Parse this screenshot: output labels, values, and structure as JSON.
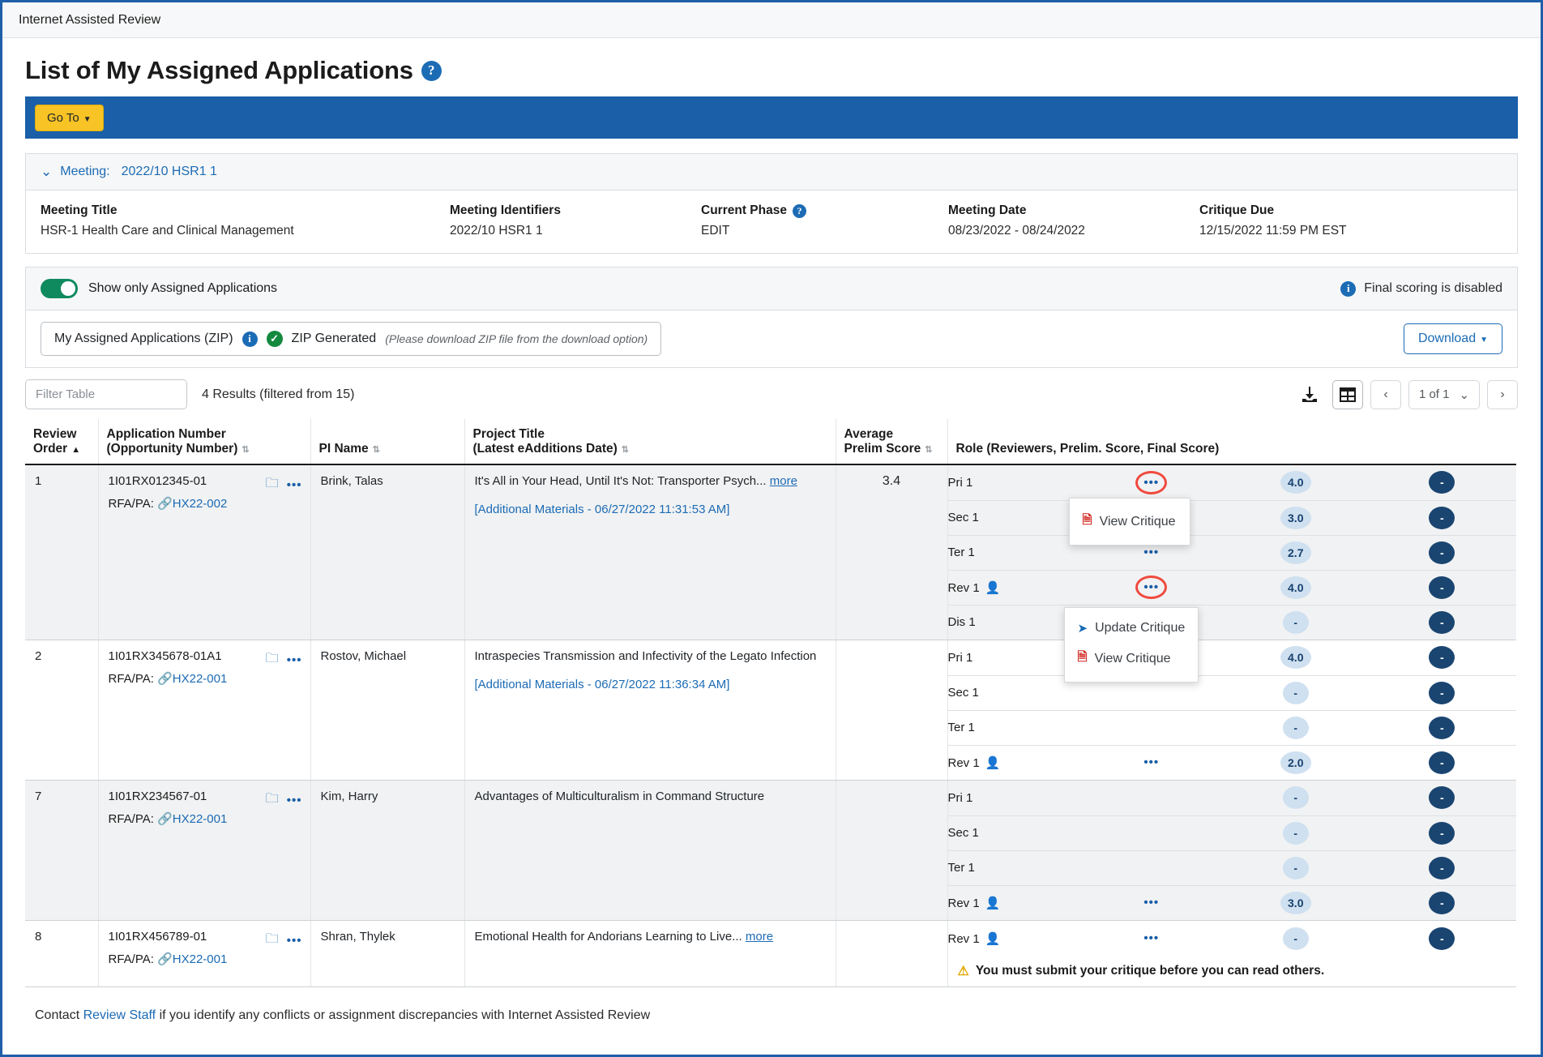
{
  "window": {
    "title": "Internet Assisted Review"
  },
  "header": {
    "page_title": "List of My Assigned Applications",
    "help_icon": "question-circle-icon",
    "goto_label": "Go To"
  },
  "meeting_panel": {
    "collapse_icon": "chevron-down-icon",
    "header_label": "Meeting:",
    "header_value": "2022/10 HSR1 1",
    "fields": [
      {
        "label": "Meeting Title",
        "value": "HSR-1 Health Care and Clinical Management"
      },
      {
        "label": "Meeting Identifiers",
        "value": "2022/10 HSR1 1"
      },
      {
        "label": "Current Phase",
        "value": "EDIT",
        "help": true
      },
      {
        "label": "Meeting Date",
        "value": "08/23/2022 - 08/24/2022"
      },
      {
        "label": "Critique Due",
        "value": "12/15/2022 11:59 PM EST"
      }
    ]
  },
  "toolbar": {
    "toggle_label": "Show only Assigned Applications",
    "toggle_on": true,
    "final_scoring_text": "Final scoring is disabled",
    "info_icon": "info-circle-icon"
  },
  "zip": {
    "label": "My Assigned Applications (ZIP)",
    "info_icon": "info-circle-icon",
    "status_icon": "check-circle-icon",
    "status": "ZIP Generated",
    "note": "(Please download ZIP file from the download option)",
    "download_label": "Download"
  },
  "table_controls": {
    "filter_placeholder": "Filter Table",
    "filter_value": "",
    "results_text": "4 Results (filtered from 15)",
    "download_icon": "download-icon",
    "grid_icon": "table-grid-icon",
    "prev_icon": "chevron-left-icon",
    "next_icon": "chevron-right-icon",
    "page_label": "1 of 1",
    "page_caret_icon": "chevron-down-icon"
  },
  "table": {
    "columns": [
      {
        "line1": "Review",
        "line2": "Order",
        "sort": "asc"
      },
      {
        "line1": "Application Number",
        "line2": "(Opportunity Number)",
        "sort": "both"
      },
      {
        "line1": "",
        "line2": "PI Name",
        "sort": "both"
      },
      {
        "line1": "Project Title",
        "line2": "(Latest eAdditions Date)",
        "sort": "both"
      },
      {
        "line1": "Average",
        "line2": "Prelim Score",
        "sort": "both"
      },
      {
        "line1": "",
        "line2": "Role (Reviewers, Prelim. Score, Final Score)",
        "sort": "none"
      }
    ],
    "rows": [
      {
        "order": "1",
        "app_number": "1I01RX012345-01",
        "rfa_label": "RFA/PA:",
        "rfa_link": "HX22-002",
        "folder_icon": "folder-open-icon",
        "more_icon": "ellipsis-icon",
        "pi_name": "Brink, Talas",
        "title": "It's All in Your Head, Until It's Not: Transporter Psych...",
        "more_label": "more",
        "additional": "[Additional Materials - 06/27/2022 11:31:53 AM]",
        "avg_score": "3.4",
        "roles": [
          {
            "name": "Pri 1",
            "person": false,
            "dots": true,
            "highlight": true,
            "prelim": "4.0",
            "final": "-"
          },
          {
            "name": "Sec 1",
            "person": false,
            "dots": false,
            "highlight": false,
            "prelim": "3.0",
            "final": "-"
          },
          {
            "name": "Ter 1",
            "person": false,
            "dots": true,
            "highlight": false,
            "prelim": "2.7",
            "final": "-"
          },
          {
            "name": "Rev 1",
            "person": true,
            "dots": true,
            "highlight": true,
            "prelim": "4.0",
            "final": "-"
          },
          {
            "name": "Dis 1",
            "person": false,
            "dots": false,
            "highlight": false,
            "prelim": "-",
            "final": "-"
          }
        ]
      },
      {
        "order": "2",
        "app_number": "1I01RX345678-01A1",
        "rfa_label": "RFA/PA:",
        "rfa_link": "HX22-001",
        "folder_icon": "folder-open-icon",
        "more_icon": "ellipsis-icon",
        "pi_name": "Rostov, Michael",
        "title": "Intraspecies Transmission and Infectivity of the Legato Infection",
        "more_label": "",
        "additional": "[Additional Materials - 06/27/2022 11:36:34 AM]",
        "avg_score": "",
        "roles": [
          {
            "name": "Pri 1",
            "person": false,
            "dots": true,
            "highlight": false,
            "prelim": "4.0",
            "final": "-"
          },
          {
            "name": "Sec 1",
            "person": false,
            "dots": false,
            "highlight": false,
            "prelim": "-",
            "final": "-"
          },
          {
            "name": "Ter 1",
            "person": false,
            "dots": false,
            "highlight": false,
            "prelim": "-",
            "final": "-"
          },
          {
            "name": "Rev 1",
            "person": true,
            "dots": true,
            "highlight": false,
            "prelim": "2.0",
            "final": "-"
          }
        ]
      },
      {
        "order": "7",
        "app_number": "1I01RX234567-01",
        "rfa_label": "RFA/PA:",
        "rfa_link": "HX22-001",
        "folder_icon": "folder-open-icon",
        "more_icon": "ellipsis-icon",
        "pi_name": "Kim, Harry",
        "title": "Advantages of Multiculturalism in Command Structure",
        "more_label": "",
        "additional": "",
        "avg_score": "",
        "roles": [
          {
            "name": "Pri 1",
            "person": false,
            "dots": false,
            "highlight": false,
            "prelim": "-",
            "final": "-"
          },
          {
            "name": "Sec 1",
            "person": false,
            "dots": false,
            "highlight": false,
            "prelim": "-",
            "final": "-"
          },
          {
            "name": "Ter 1",
            "person": false,
            "dots": false,
            "highlight": false,
            "prelim": "-",
            "final": "-"
          },
          {
            "name": "Rev 1",
            "person": true,
            "dots": true,
            "highlight": false,
            "prelim": "3.0",
            "final": "-"
          }
        ]
      },
      {
        "order": "8",
        "app_number": "1I01RX456789-01",
        "rfa_label": "RFA/PA:",
        "rfa_link": "HX22-001",
        "folder_icon": "folder-open-icon",
        "more_icon": "ellipsis-icon",
        "pi_name": "Shran, Thylek",
        "title": "Emotional Health for Andorians Learning to Live...",
        "more_label": "more",
        "additional": "",
        "avg_score": "",
        "roles": [
          {
            "name": "Rev 1",
            "person": true,
            "dots": true,
            "highlight": false,
            "prelim": "-",
            "final": "-"
          }
        ],
        "warning": "You must submit your critique before you can read others.",
        "warning_icon": "warning-triangle-icon"
      }
    ]
  },
  "menus": {
    "menu_a": {
      "items": [
        {
          "label": "View Critique",
          "icon": "pdf-file-icon"
        }
      ]
    },
    "menu_b": {
      "items": [
        {
          "label": "Update Critique",
          "icon": "paper-plane-icon"
        },
        {
          "label": "View Critique",
          "icon": "pdf-file-icon"
        }
      ]
    }
  },
  "footer": {
    "prefix": "Contact ",
    "link": "Review Staff",
    "suffix": " if you identify any conflicts or assignment discrepancies with Internet Assisted Review"
  },
  "colors": {
    "primary_blue": "#1a5fa8",
    "accent_yellow": "#f7c325",
    "link_blue": "#1c6bb5",
    "toggle_green": "#0f8a5f",
    "highlight_red": "#f04a3f",
    "pill_light": "#cfe0f0",
    "pill_dark": "#1a4571"
  }
}
